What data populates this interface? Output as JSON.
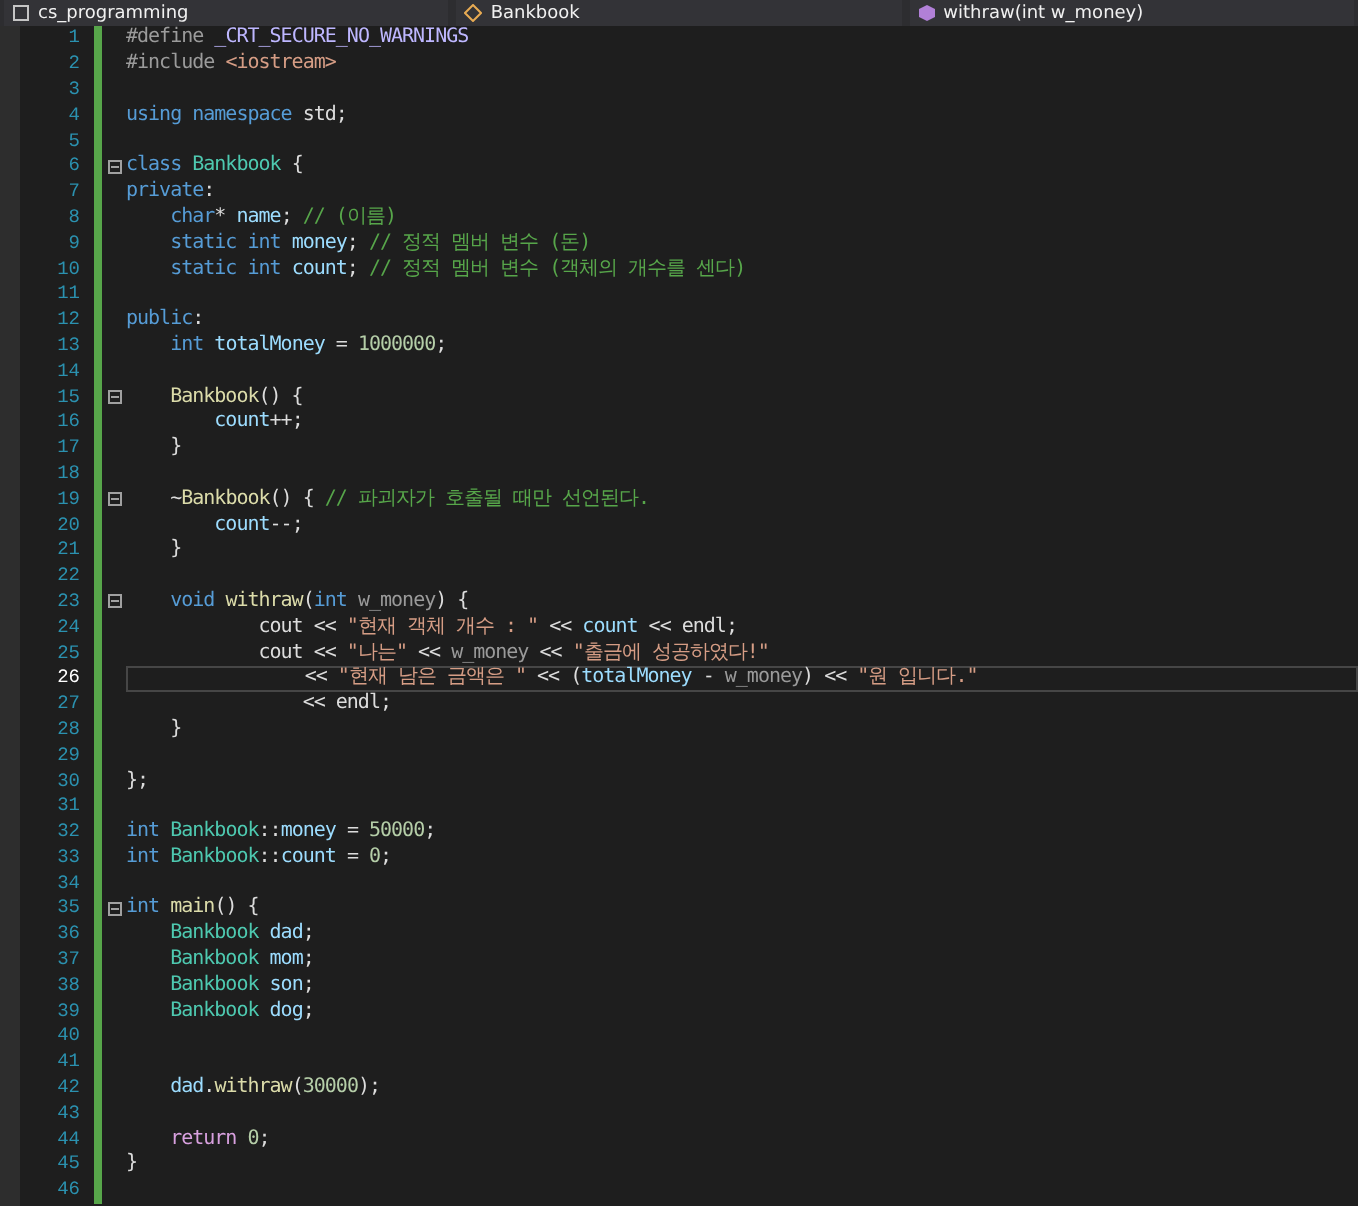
{
  "nav_bar": [
    {
      "label": "cs_programming",
      "kind": "project"
    },
    {
      "label": "Bankbook",
      "kind": "class"
    },
    {
      "label": "withraw(int w_money)",
      "kind": "method"
    }
  ],
  "lines": [
    {
      "number": "1",
      "current": false,
      "fold": false,
      "tokens": [
        {
          "kind": "pp",
          "text": "#define "
        },
        {
          "kind": "m",
          "text": "_CRT_SECURE_NO_WARNINGS"
        }
      ]
    },
    {
      "number": "2",
      "current": false,
      "fold": false,
      "tokens": [
        {
          "kind": "pp",
          "text": "#include "
        },
        {
          "kind": "s",
          "text": "<iostream>"
        }
      ]
    },
    {
      "number": "3",
      "current": false,
      "fold": false
    },
    {
      "number": "4",
      "current": false,
      "fold": false,
      "tokens": [
        {
          "kind": "k",
          "text": "using namespace "
        },
        {
          "kind": "p",
          "text": "std;"
        }
      ]
    },
    {
      "number": "5",
      "current": false,
      "fold": false
    },
    {
      "number": "6",
      "current": false,
      "fold": true,
      "tokens": [
        {
          "kind": "k",
          "text": "class "
        },
        {
          "kind": "t",
          "text": "Bankbook"
        },
        {
          "kind": "p",
          "text": " {"
        }
      ]
    },
    {
      "number": "7",
      "current": false,
      "fold": false,
      "tokens": [
        {
          "kind": "k",
          "text": "private"
        },
        {
          "kind": "p",
          "text": ":"
        }
      ]
    },
    {
      "number": "8",
      "current": false,
      "fold": false,
      "tokens": [
        {
          "kind": "k",
          "text": "    char"
        },
        {
          "kind": "p",
          "text": "* "
        },
        {
          "kind": "v",
          "text": "name"
        },
        {
          "kind": "p",
          "text": "; "
        },
        {
          "kind": "c",
          "text": "// (이름)"
        }
      ]
    },
    {
      "number": "9",
      "current": false,
      "fold": false,
      "tokens": [
        {
          "kind": "k",
          "text": "    static int "
        },
        {
          "kind": "v",
          "text": "money"
        },
        {
          "kind": "p",
          "text": "; "
        },
        {
          "kind": "c",
          "text": "// 정적 멤버 변수 (돈)"
        }
      ]
    },
    {
      "number": "10",
      "current": false,
      "fold": false,
      "tokens": [
        {
          "kind": "k",
          "text": "    static int "
        },
        {
          "kind": "v",
          "text": "count"
        },
        {
          "kind": "p",
          "text": "; "
        },
        {
          "kind": "c",
          "text": "// 정적 멤버 변수 (객체의 개수를 센다)"
        }
      ]
    },
    {
      "number": "11",
      "current": false,
      "fold": false
    },
    {
      "number": "12",
      "current": false,
      "fold": false,
      "tokens": [
        {
          "kind": "k",
          "text": "public"
        },
        {
          "kind": "p",
          "text": ":"
        }
      ]
    },
    {
      "number": "13",
      "current": false,
      "fold": false,
      "tokens": [
        {
          "kind": "k",
          "text": "    int "
        },
        {
          "kind": "v",
          "text": "totalMoney"
        },
        {
          "kind": "p",
          "text": " = "
        },
        {
          "kind": "n",
          "text": "1000000"
        },
        {
          "kind": "p",
          "text": ";"
        }
      ]
    },
    {
      "number": "14",
      "current": false,
      "fold": false
    },
    {
      "number": "15",
      "current": false,
      "fold": true,
      "tokens": [
        {
          "kind": "f",
          "text": "    Bankbook"
        },
        {
          "kind": "p",
          "text": "() {"
        }
      ]
    },
    {
      "number": "16",
      "current": false,
      "fold": false,
      "tokens": [
        {
          "kind": "v",
          "text": "        count"
        },
        {
          "kind": "p",
          "text": "++;"
        }
      ]
    },
    {
      "number": "17",
      "current": false,
      "fold": false,
      "tokens": [
        {
          "kind": "p",
          "text": "    }"
        }
      ]
    },
    {
      "number": "18",
      "current": false,
      "fold": false
    },
    {
      "number": "19",
      "current": false,
      "fold": true,
      "tokens": [
        {
          "kind": "p",
          "text": "    ~"
        },
        {
          "kind": "f",
          "text": "Bankbook"
        },
        {
          "kind": "p",
          "text": "() { "
        },
        {
          "kind": "c",
          "text": "// 파괴자가 호출될 때만 선언된다."
        }
      ]
    },
    {
      "number": "20",
      "current": false,
      "fold": false,
      "tokens": [
        {
          "kind": "v",
          "text": "        count"
        },
        {
          "kind": "p",
          "text": "--;"
        }
      ]
    },
    {
      "number": "21",
      "current": false,
      "fold": false,
      "tokens": [
        {
          "kind": "p",
          "text": "    }"
        }
      ]
    },
    {
      "number": "22",
      "current": false,
      "fold": false
    },
    {
      "number": "23",
      "current": false,
      "fold": true,
      "tokens": [
        {
          "kind": "k",
          "text": "    void "
        },
        {
          "kind": "f",
          "text": "withraw"
        },
        {
          "kind": "p",
          "text": "("
        },
        {
          "kind": "k",
          "text": "int "
        },
        {
          "kind": "g",
          "text": "w_money"
        },
        {
          "kind": "p",
          "text": ") {"
        }
      ]
    },
    {
      "number": "24",
      "current": false,
      "fold": false,
      "tokens": [
        {
          "kind": "p",
          "text": "            cout << "
        },
        {
          "kind": "s",
          "text": "\"현재 객체 개수 : \""
        },
        {
          "kind": "p",
          "text": " << "
        },
        {
          "kind": "v",
          "text": "count"
        },
        {
          "kind": "p",
          "text": " << endl;"
        }
      ]
    },
    {
      "number": "25",
      "current": false,
      "fold": false,
      "tokens": [
        {
          "kind": "p",
          "text": "            cout << "
        },
        {
          "kind": "s",
          "text": "\"나는\""
        },
        {
          "kind": "p",
          "text": " << "
        },
        {
          "kind": "g",
          "text": "w_money"
        },
        {
          "kind": "p",
          "text": " << "
        },
        {
          "kind": "s",
          "text": "\"출금에 성공하였다!\""
        }
      ]
    },
    {
      "number": "26",
      "current": true,
      "fold": false,
      "tokens": [
        {
          "kind": "p",
          "text": "                << "
        },
        {
          "kind": "s",
          "text": "\"현재 남은 금액은 \""
        },
        {
          "kind": "p",
          "text": " << ("
        },
        {
          "kind": "v",
          "text": "totalMoney"
        },
        {
          "kind": "p",
          "text": " - "
        },
        {
          "kind": "g",
          "text": "w_money"
        },
        {
          "kind": "p",
          "text": ") << "
        },
        {
          "kind": "s",
          "text": "\"원 입니다.\""
        }
      ]
    },
    {
      "number": "27",
      "current": false,
      "fold": false,
      "tokens": [
        {
          "kind": "p",
          "text": "                << endl;"
        }
      ]
    },
    {
      "number": "28",
      "current": false,
      "fold": false,
      "tokens": [
        {
          "kind": "p",
          "text": "    }"
        }
      ]
    },
    {
      "number": "29",
      "current": false,
      "fold": false
    },
    {
      "number": "30",
      "current": false,
      "fold": false,
      "tokens": [
        {
          "kind": "p",
          "text": "};"
        }
      ]
    },
    {
      "number": "31",
      "current": false,
      "fold": false
    },
    {
      "number": "32",
      "current": false,
      "fold": false,
      "tokens": [
        {
          "kind": "k",
          "text": "int "
        },
        {
          "kind": "t",
          "text": "Bankbook"
        },
        {
          "kind": "p",
          "text": "::"
        },
        {
          "kind": "v",
          "text": "money"
        },
        {
          "kind": "p",
          "text": " = "
        },
        {
          "kind": "n",
          "text": "50000"
        },
        {
          "kind": "p",
          "text": ";"
        }
      ]
    },
    {
      "number": "33",
      "current": false,
      "fold": false,
      "tokens": [
        {
          "kind": "k",
          "text": "int "
        },
        {
          "kind": "t",
          "text": "Bankbook"
        },
        {
          "kind": "p",
          "text": "::"
        },
        {
          "kind": "v",
          "text": "count"
        },
        {
          "kind": "p",
          "text": " = "
        },
        {
          "kind": "n",
          "text": "0"
        },
        {
          "kind": "p",
          "text": ";"
        }
      ]
    },
    {
      "number": "34",
      "current": false,
      "fold": false
    },
    {
      "number": "35",
      "current": false,
      "fold": true,
      "tokens": [
        {
          "kind": "k",
          "text": "int "
        },
        {
          "kind": "f",
          "text": "main"
        },
        {
          "kind": "p",
          "text": "() {"
        }
      ]
    },
    {
      "number": "36",
      "current": false,
      "fold": false,
      "tokens": [
        {
          "kind": "t",
          "text": "    Bankbook "
        },
        {
          "kind": "v",
          "text": "dad"
        },
        {
          "kind": "p",
          "text": ";"
        }
      ]
    },
    {
      "number": "37",
      "current": false,
      "fold": false,
      "tokens": [
        {
          "kind": "t",
          "text": "    Bankbook "
        },
        {
          "kind": "v",
          "text": "mom"
        },
        {
          "kind": "p",
          "text": ";"
        }
      ]
    },
    {
      "number": "38",
      "current": false,
      "fold": false,
      "tokens": [
        {
          "kind": "t",
          "text": "    Bankbook "
        },
        {
          "kind": "v",
          "text": "son"
        },
        {
          "kind": "p",
          "text": ";"
        }
      ]
    },
    {
      "number": "39",
      "current": false,
      "fold": false,
      "tokens": [
        {
          "kind": "t",
          "text": "    Bankbook "
        },
        {
          "kind": "v",
          "text": "dog"
        },
        {
          "kind": "p",
          "text": ";"
        }
      ]
    },
    {
      "number": "40",
      "current": false,
      "fold": false
    },
    {
      "number": "41",
      "current": false,
      "fold": false
    },
    {
      "number": "42",
      "current": false,
      "fold": false,
      "tokens": [
        {
          "kind": "v",
          "text": "    dad"
        },
        {
          "kind": "p",
          "text": "."
        },
        {
          "kind": "f",
          "text": "withraw"
        },
        {
          "kind": "p",
          "text": "("
        },
        {
          "kind": "n",
          "text": "30000"
        },
        {
          "kind": "p",
          "text": ");"
        }
      ]
    },
    {
      "number": "43",
      "current": false,
      "fold": false
    },
    {
      "number": "44",
      "current": false,
      "fold": false,
      "tokens": [
        {
          "kind": "r",
          "text": "    return "
        },
        {
          "kind": "n",
          "text": "0"
        },
        {
          "kind": "p",
          "text": ";"
        }
      ]
    },
    {
      "number": "45",
      "current": false,
      "fold": false,
      "tokens": [
        {
          "kind": "p",
          "text": "}"
        }
      ]
    },
    {
      "number": "46",
      "current": false,
      "fold": false
    }
  ]
}
